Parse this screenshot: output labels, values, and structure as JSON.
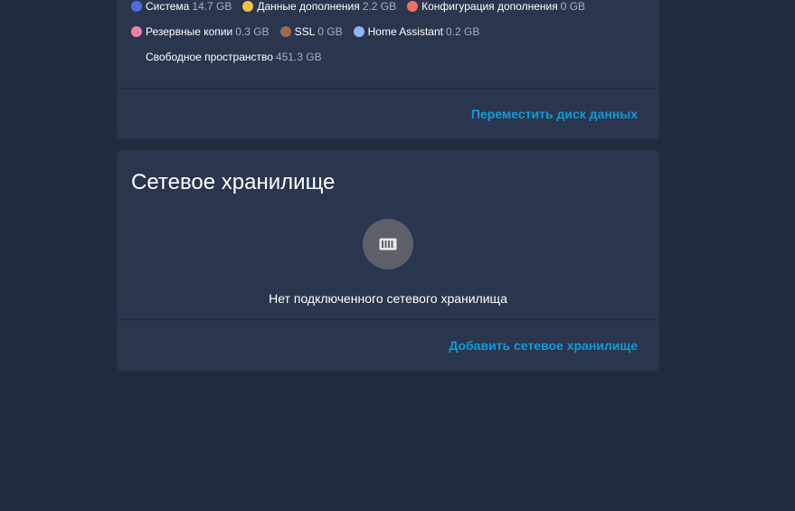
{
  "storage": {
    "legend_row1": [
      {
        "label": "Система",
        "size": "14.7 GB",
        "color": "#4a6fe0"
      },
      {
        "label": "Данные дополнения",
        "size": "2.2 GB",
        "color": "#f5c144"
      },
      {
        "label": "Конфигурация дополнения",
        "size": "0 GB",
        "color": "#f0705f"
      }
    ],
    "legend_row2": [
      {
        "label": "Резервные копии",
        "size": "0.3 GB",
        "color": "#f080a6"
      },
      {
        "label": "SSL",
        "size": "0 GB",
        "color": "#9a6b4e"
      },
      {
        "label": "Home Assistant",
        "size": "0.2 GB",
        "color": "#8fb4f0"
      }
    ],
    "free": {
      "label": "Свободное пространство",
      "size": "451.3 GB"
    },
    "move_action": "Переместить диск данных"
  },
  "network_storage": {
    "title": "Сетевое хранилище",
    "icon": "nas-icon",
    "empty_text": "Нет подключенного сетевого хранилища",
    "add_action": "Добавить сетевое хранилище"
  }
}
